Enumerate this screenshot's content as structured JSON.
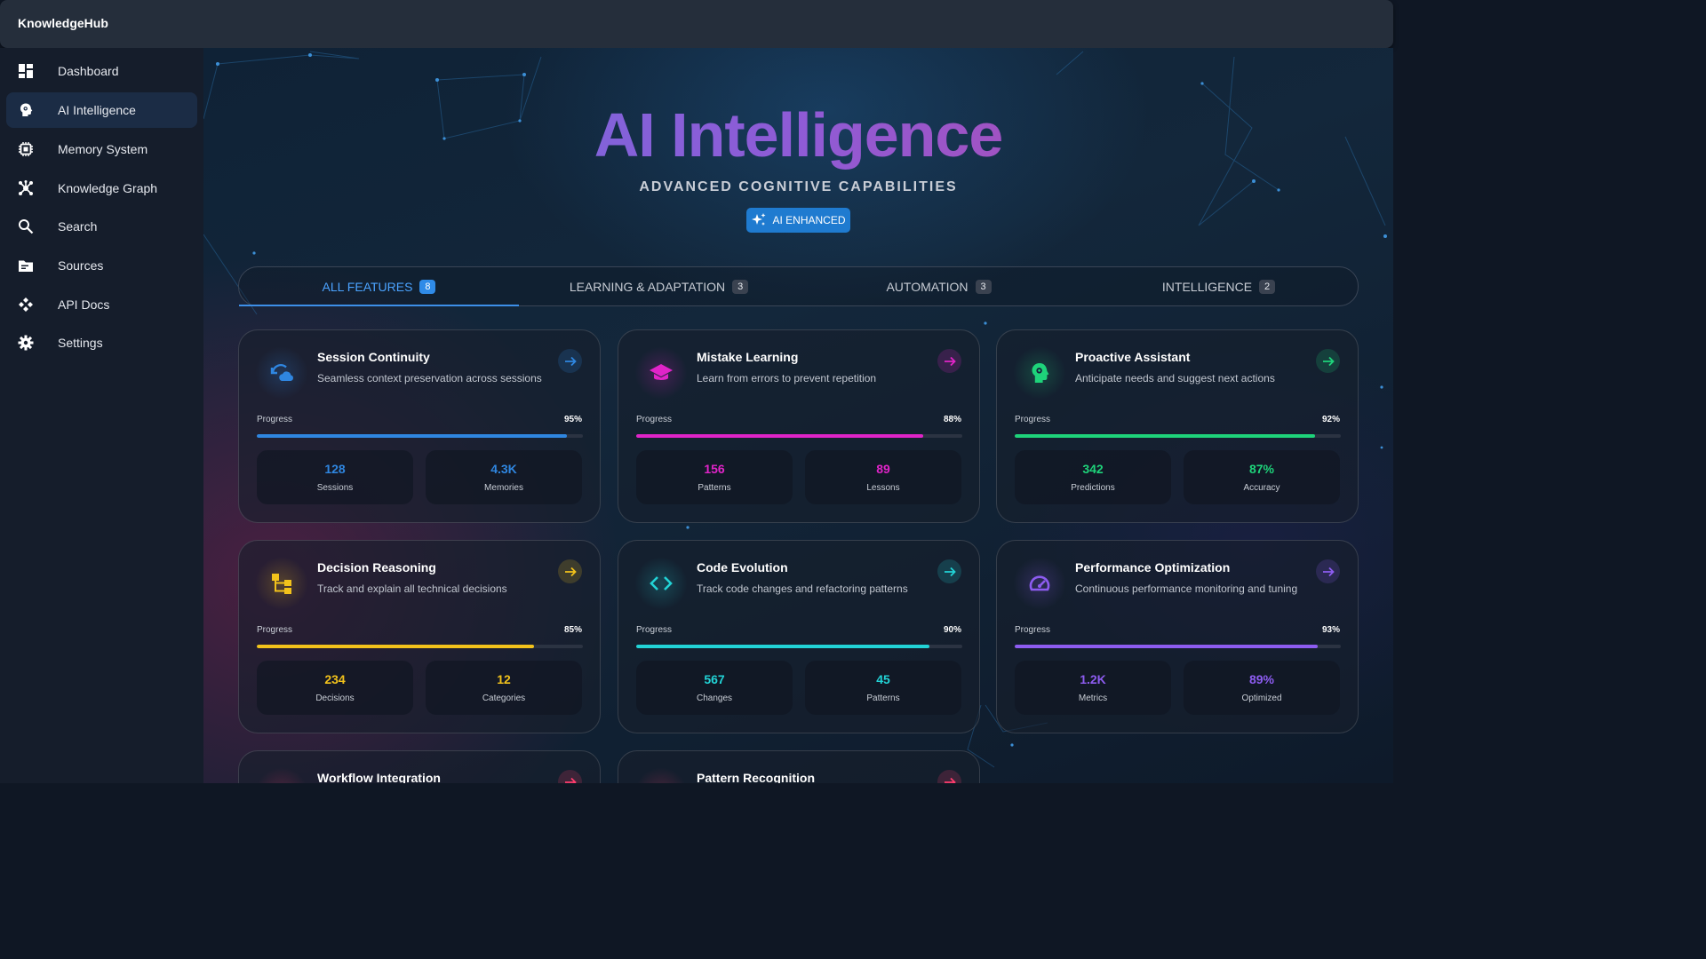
{
  "app": {
    "brand": "KnowledgeHub"
  },
  "sidebar": {
    "items": [
      {
        "label": "Dashboard",
        "icon": "dashboard-icon"
      },
      {
        "label": "AI Intelligence",
        "icon": "brain-icon",
        "active": true
      },
      {
        "label": "Memory System",
        "icon": "chip-icon"
      },
      {
        "label": "Knowledge Graph",
        "icon": "graph-icon"
      },
      {
        "label": "Search",
        "icon": "search-icon"
      },
      {
        "label": "Sources",
        "icon": "folder-icon"
      },
      {
        "label": "API Docs",
        "icon": "api-icon"
      },
      {
        "label": "Settings",
        "icon": "gear-icon"
      }
    ]
  },
  "hero": {
    "title": "AI Intelligence",
    "subtitle": "ADVANCED COGNITIVE CAPABILITIES",
    "badge": "AI ENHANCED"
  },
  "tabs": [
    {
      "label": "ALL FEATURES",
      "count": "8",
      "active": true
    },
    {
      "label": "LEARNING & ADAPTATION",
      "count": "3"
    },
    {
      "label": "AUTOMATION",
      "count": "3"
    },
    {
      "label": "INTELLIGENCE",
      "count": "2"
    }
  ],
  "progress_label": "Progress",
  "cards": [
    {
      "title": "Session Continuity",
      "desc": "Seamless context preservation across sessions",
      "progress": "95%",
      "progress_value": 95,
      "color": "#2f86e0",
      "icon": "sync-cloud-icon",
      "stats": [
        {
          "value": "128",
          "label": "Sessions"
        },
        {
          "value": "4.3K",
          "label": "Memories"
        }
      ]
    },
    {
      "title": "Mistake Learning",
      "desc": "Learn from errors to prevent repetition",
      "progress": "88%",
      "progress_value": 88,
      "color": "#e024c8",
      "icon": "graduation-cap-icon",
      "stats": [
        {
          "value": "156",
          "label": "Patterns"
        },
        {
          "value": "89",
          "label": "Lessons"
        }
      ]
    },
    {
      "title": "Proactive Assistant",
      "desc": "Anticipate needs and suggest next actions",
      "progress": "92%",
      "progress_value": 92,
      "color": "#1ed37a",
      "icon": "brain-icon",
      "stats": [
        {
          "value": "342",
          "label": "Predictions"
        },
        {
          "value": "87%",
          "label": "Accuracy"
        }
      ]
    },
    {
      "title": "Decision Reasoning",
      "desc": "Track and explain all technical decisions",
      "progress": "85%",
      "progress_value": 85,
      "color": "#f2c21b",
      "icon": "decision-tree-icon",
      "stats": [
        {
          "value": "234",
          "label": "Decisions"
        },
        {
          "value": "12",
          "label": "Categories"
        }
      ]
    },
    {
      "title": "Code Evolution",
      "desc": "Track code changes and refactoring patterns",
      "progress": "90%",
      "progress_value": 90,
      "color": "#22d3d6",
      "icon": "code-icon",
      "stats": [
        {
          "value": "567",
          "label": "Changes"
        },
        {
          "value": "45",
          "label": "Patterns"
        }
      ]
    },
    {
      "title": "Performance Optimization",
      "desc": "Continuous performance monitoring and tuning",
      "progress": "93%",
      "progress_value": 93,
      "color": "#8d5cf0",
      "icon": "speedometer-icon",
      "stats": [
        {
          "value": "1.2K",
          "label": "Metrics"
        },
        {
          "value": "89%",
          "label": "Optimized"
        }
      ]
    },
    {
      "title": "Workflow Integration",
      "color": "#ff3d6e",
      "icon": "workflow-icon"
    },
    {
      "title": "Pattern Recognition",
      "color": "#ff3d6e",
      "icon": "pattern-icon"
    }
  ]
}
